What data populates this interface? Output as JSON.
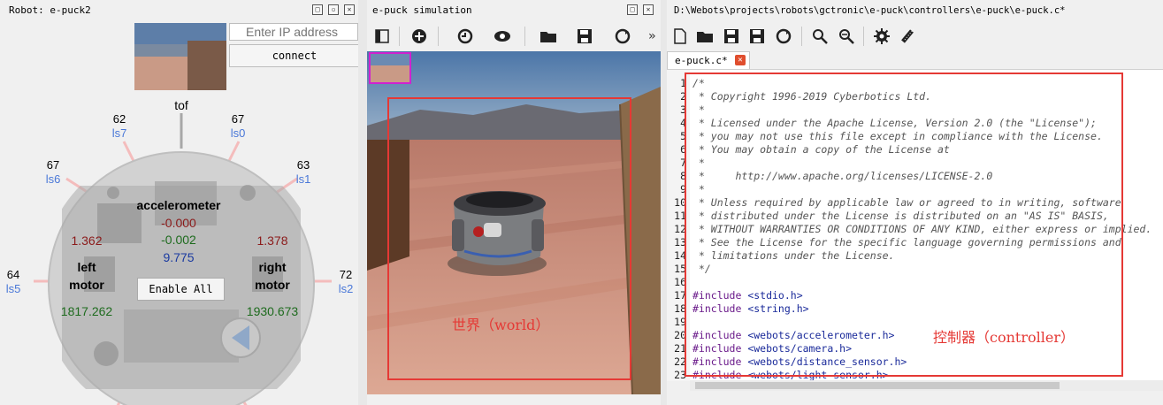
{
  "robot_panel": {
    "title": "Robot: e-puck2",
    "ip_placeholder": "Enter IP address",
    "connect_label": "connect",
    "tof": {
      "label": "tof"
    },
    "sensors": [
      {
        "name": "ls7",
        "value": "62"
      },
      {
        "name": "ls0",
        "value": "67"
      },
      {
        "name": "ls6",
        "value": "67"
      },
      {
        "name": "ls1",
        "value": "63"
      },
      {
        "name": "ls5",
        "value": "64"
      },
      {
        "name": "ls2",
        "value": "72"
      }
    ],
    "accelerometer": {
      "label": "accelerometer",
      "x": "-0.000",
      "y": "-0.002",
      "z": "9.775"
    },
    "left_motor": {
      "label1": "left",
      "label2": "motor",
      "value": "1.362",
      "position": "1817.262"
    },
    "right_motor": {
      "label1": "right",
      "label2": "motor",
      "value": "1.378",
      "position": "1930.673"
    },
    "enable_all_label": "Enable All"
  },
  "simulation_panel": {
    "title": "e-puck simulation",
    "overflow_label": "»",
    "annotation": "世界（world）"
  },
  "editor_panel": {
    "title": "D:\\Webots\\projects\\robots\\gctronic\\e-puck\\controllers\\e-puck\\e-puck.c*",
    "tab_label": "e-puck.c*",
    "annotation": "控制器（controller）",
    "lines": [
      {
        "n": "1",
        "text": "/*"
      },
      {
        "n": "2",
        "text": " * Copyright 1996-2019 Cyberbotics Ltd."
      },
      {
        "n": "3",
        "text": " *"
      },
      {
        "n": "4",
        "text": " * Licensed under the Apache License, Version 2.0 (the \"License\");"
      },
      {
        "n": "5",
        "text": " * you may not use this file except in compliance with the License."
      },
      {
        "n": "6",
        "text": " * You may obtain a copy of the License at"
      },
      {
        "n": "7",
        "text": " *"
      },
      {
        "n": "8",
        "text": " *     http://www.apache.org/licenses/LICENSE-2.0"
      },
      {
        "n": "9",
        "text": " *"
      },
      {
        "n": "10",
        "text": " * Unless required by applicable law or agreed to in writing, software"
      },
      {
        "n": "11",
        "text": " * distributed under the License is distributed on an \"AS IS\" BASIS,"
      },
      {
        "n": "12",
        "text": " * WITHOUT WARRANTIES OR CONDITIONS OF ANY KIND, either express or implied."
      },
      {
        "n": "13",
        "text": " * See the License for the specific language governing permissions and"
      },
      {
        "n": "14",
        "text": " * limitations under the License."
      },
      {
        "n": "15",
        "text": " */"
      },
      {
        "n": "16",
        "text": ""
      },
      {
        "n": "17",
        "text": "#include <stdio.h>"
      },
      {
        "n": "18",
        "text": "#include <string.h>"
      },
      {
        "n": "19",
        "text": ""
      },
      {
        "n": "20",
        "text": "#include <webots/accelerometer.h>"
      },
      {
        "n": "21",
        "text": "#include <webots/camera.h>"
      },
      {
        "n": "22",
        "text": "#include <webots/distance_sensor.h>"
      },
      {
        "n": "23",
        "text": "#include <webots/light_sensor.h>"
      }
    ]
  },
  "colors": {
    "annotation_red": "#e53935",
    "sensor_blue": "#4a78d8",
    "dark_red": "#8b1a1a",
    "green": "#1e6b1e",
    "navy": "#1a3aa0",
    "comment_gray": "#555555",
    "include_purple": "#6a1a8a",
    "include_blue": "#1a2a9a"
  }
}
